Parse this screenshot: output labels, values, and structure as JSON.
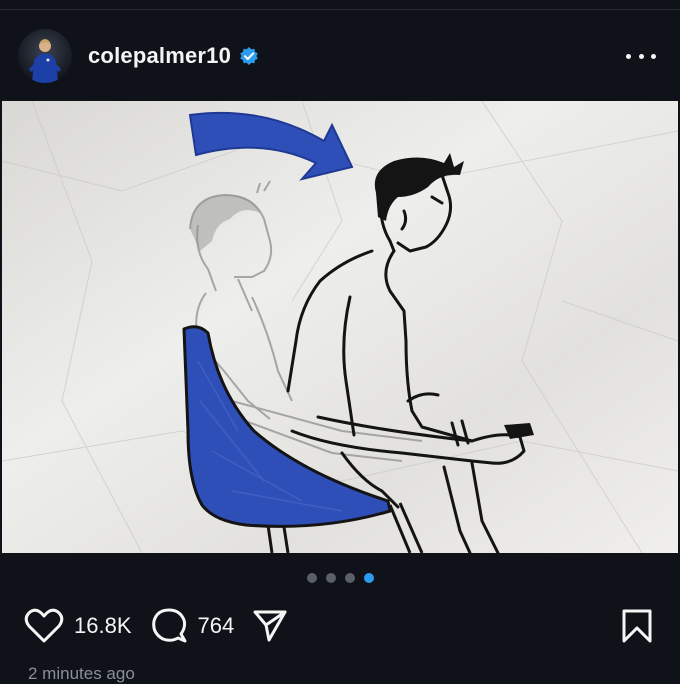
{
  "post": {
    "username": "colepalmer10",
    "verified": true,
    "more_label": "more options",
    "likes": "16.8K",
    "comments": "764",
    "timestamp": "2 minutes ago",
    "carousel": {
      "total": 4,
      "active_index": 3
    }
  },
  "colors": {
    "background": "#0f1218",
    "accent_blue": "#2c9cf0",
    "illustration_blue": "#2f4fb8"
  },
  "icons": {
    "like": "heart-icon",
    "comment": "comment-bubble-icon",
    "share": "paper-plane-icon",
    "save": "bookmark-icon",
    "verified": "verified-badge-icon",
    "more": "more-dots-icon"
  }
}
